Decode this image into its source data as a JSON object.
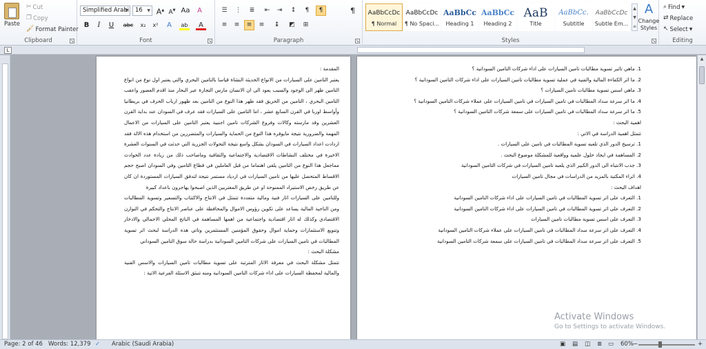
{
  "ribbon": {
    "clipboard": {
      "label": "Clipboard",
      "paste": "Paste",
      "cut": "Cut",
      "copy": "Copy",
      "format_painter": "Format Painter"
    },
    "font": {
      "label": "Font",
      "font_name": "Simplified Arabi",
      "font_size": "16",
      "grow": "A",
      "shrink": "A",
      "aa": "Aa",
      "clear": "A",
      "bold": "B",
      "italic": "I",
      "underline": "U",
      "strike": "abc",
      "sub": "x₂",
      "sup": "x²",
      "effects": "A",
      "highlight": "ab",
      "color": "A"
    },
    "paragraph": {
      "label": "Paragraph",
      "pilcrow": "¶"
    },
    "styles": {
      "label": "Styles",
      "items": [
        {
          "sample": "AaBbCcDc",
          "name": "¶ Normal"
        },
        {
          "sample": "AaBbCcDc",
          "name": "¶ No Spaci..."
        },
        {
          "sample": "AaBbCc",
          "name": "Heading 1"
        },
        {
          "sample": "AaBbCc",
          "name": "Heading 2"
        },
        {
          "sample": "AaB",
          "name": "Title"
        },
        {
          "sample": "AaBbCc.",
          "name": "Subtitle"
        },
        {
          "sample": "AaBbCcDc",
          "name": "Subtle Em..."
        }
      ],
      "change_styles": "Change Styles"
    },
    "editing": {
      "label": "Editing",
      "find": "Find",
      "replace": "Replace",
      "select": "Select"
    }
  },
  "ruler_tab": "L",
  "left_page": {
    "paragraphs": [
      "المقدمة :",
      "يعتبر التامين على السيارات من الانواع الحديثة النشاة قياسا بالتامين البحري والتي يعتبر اول نوع من انواع التامين ظهر الى الوجود والسبب يعود الى ان الانسان مارس التجارة عبر البحار منذ اقدم العصور واعقب التامين البحري ، التامين من الحريق فقد ظهر هذا النوع من التامين بعد ظهور ارباب الحرف في بريطانيا وأواسط اوربا في القرن السابع عشر ، اما التامين على السيارات فقد عرف في السودان عند بداية القرن العشرين وقد مارسته وكالات وفروع الشركات تامين اجنبية يعتبر التامين على السيارات من الاعمال المهمة والضرورية نتيجة مايوفره هذا النوع من الحماية والسيارات والمتضررين من استخدام هذه الالة فقد ازدادت اعداد السيارات في السودان بشكل واسع نتيجة التحولات الجزرية التي حدثت في السنوات العشرة الاخيرة في مختلف النشاطات الاقتصادية والاجتماعية والثقافية وماصاحب ذلك من زيادة عدد الحوادث مماجعل هذا النوع من التامين يلقى اهتماما من قبل العاملين في قطاع التامين وفي السودان اصبح حجم الاقساط المتحصل عليها من تامين السيارات في ازدياد مستمر نتيجة لتدفق السيارات المستوردة ان كان عن طريق رخص الاستيراد الممنوحة او عن طريق المغتربين الذين اصبحوا يهاجرون باعداد كبيرة",
      "وللتامين على السيارات اثار فنية ومالية متعددة تتمثل في الانتاج والاكتتاب والتسعير وتسوية المطالبات ومن الناحية المالية يساعد على تكوين رؤوس الاموال والمحافظة على عناصر الانتاج والتحكم في التوازن الاقتصادي وكذلك له اثار اقتصادية واجتماعية من اهمها المساهمة في الناتج المحلي الاجمالي والادخار وتنويع الاستثمارات وحماية اموال وحقوق المؤمنين المستثمرين وتاتي هذه الدراسة لبحث اثر تسوية المطالبات في تامين السيارات على شركات التامين السودانية بدراسة حالة سوق التامين السوداني",
      "مشكلة البحث :",
      "تتمثل مشكلة البحث في معرفة الاثار المترتبة على تسوية مطالبات تامين السيارات والاسس الفنية والمالية لمحفظة السيارات على اداء شركات التامين السودانية ومنه تنبثق الاسئلة الفرعية الاتية :"
    ]
  },
  "right_page": {
    "paragraphs": [
      "1. ماهي تاثير تسوية مطالبات تامين السيارات على اداء شركات التامين السودانية ؟",
      "2. ما اثر الكفاءة المالية والفنية في عملية تسوية مطالبات تامين السيارات على اداء شركات التامين السودانية ؟",
      "3. ماهي اسس تسوية مطالبات تامين السيارات ؟",
      "4. ما اثر سرعة سداد المطالبات في تامين السيارات في تامين السيارات على عملاء شركات التامين السودانية ؟",
      "5. ما اثر سرعة سداد المطالبات في تامين السيارات على سمعة شركات التامين السودانية ؟",
      "اهمية البحث :",
      "تتمثل اهمية الدراسة في الاتي :",
      "1. ترسيخ الدور الذي تلعبه تسوية المطالبات في تامين على السيارات .",
      "2. المساهمة في ايجاد حلول علمية وواقعية للمشكلة موضوع البحث .",
      "3. جذب الانتباه الى الدور الكبير الذي يلعبه تامين السيارات في شركات التامين السودانية",
      "4. اثراء المكتبة بالمزيد من الدراسات في مجال تامين السيارات",
      "اهداف البحث :",
      "1. التعرف على اثر تسوية المطالبات في تامين السيارات على اداء شركات التامين السودانية",
      "2. التعرف على اثر تسوية المطالبات في تامين السيارات على اداء شركات التامين السودانية",
      "3. التعرف على اسس تسوية مطالبات تامين السيارات",
      "4. التعرف على اثر سرعة سداد المطالبات في تامين السيارات على عملاء شركات التامين السودانية",
      "5. التعرف على اثر سرعة سداد المطالبات في تامين السيارات على سمعة شركات التامين السودانية"
    ]
  },
  "watermark": {
    "line1": "Activate Windows",
    "line2": "Go to Settings to activate Windows."
  },
  "status": {
    "page": "Page: 2 of 46",
    "words": "Words: 12,379",
    "language": "Arabic (Saudi Arabia)",
    "zoom": "60%",
    "minus": "−",
    "plus": "+"
  },
  "colors": {
    "accent": "#fbd98b",
    "ribbon_bg": "#eef2f7",
    "workspace": "#a9aeb6"
  }
}
